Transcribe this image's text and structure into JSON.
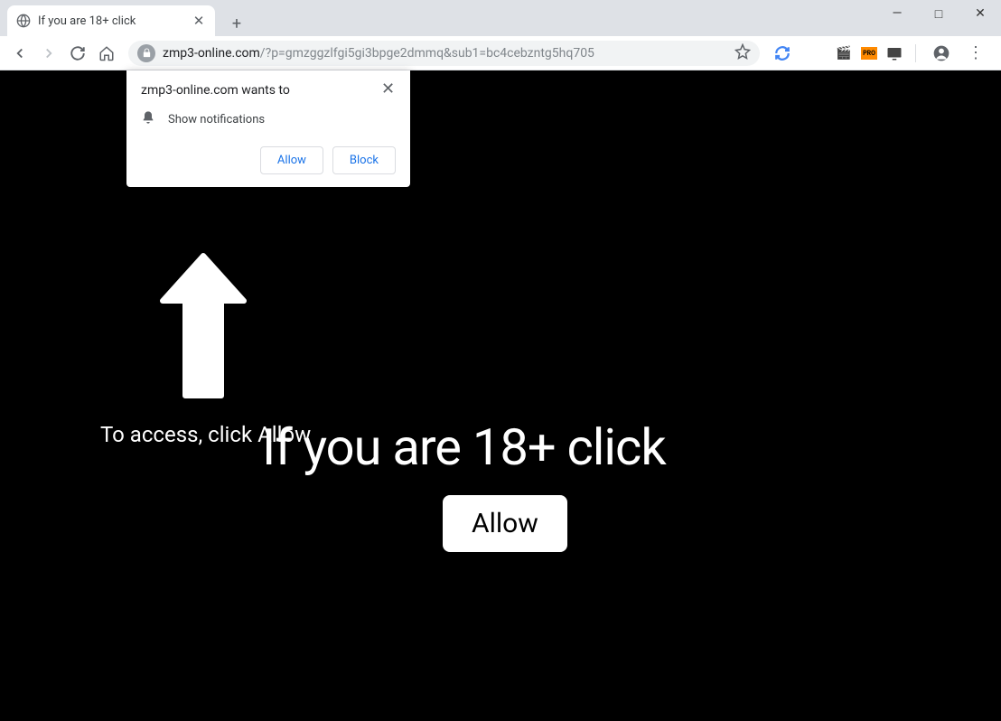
{
  "window": {
    "minimize_glyph": "—",
    "maximize_glyph": "□",
    "close_glyph": "✕"
  },
  "tab": {
    "title": "If you are 18+ click",
    "close_glyph": "✕",
    "newtab_glyph": "+"
  },
  "toolbar": {
    "url_domain": "zmp3-online.com",
    "url_path": "/?p=gmzggzlfgi5gi3bpge2dmmq&sub1=bc4cebzntg5hq705"
  },
  "extensions": {
    "sync_glyph": "↻",
    "video_glyph": "🎬",
    "pro_glyph": "▦",
    "mon_glyph": "☸",
    "profile_glyph": "👤",
    "menu_glyph": "⋮"
  },
  "permission": {
    "title": "zmp3-online.com wants to",
    "row": "Show notifications",
    "allow_label": "Allow",
    "block_label": "Block",
    "close_glyph": "✕"
  },
  "page": {
    "access_text": "To access, click Allow",
    "headline": "If you are 18+ click",
    "allow_button": "Allow"
  }
}
